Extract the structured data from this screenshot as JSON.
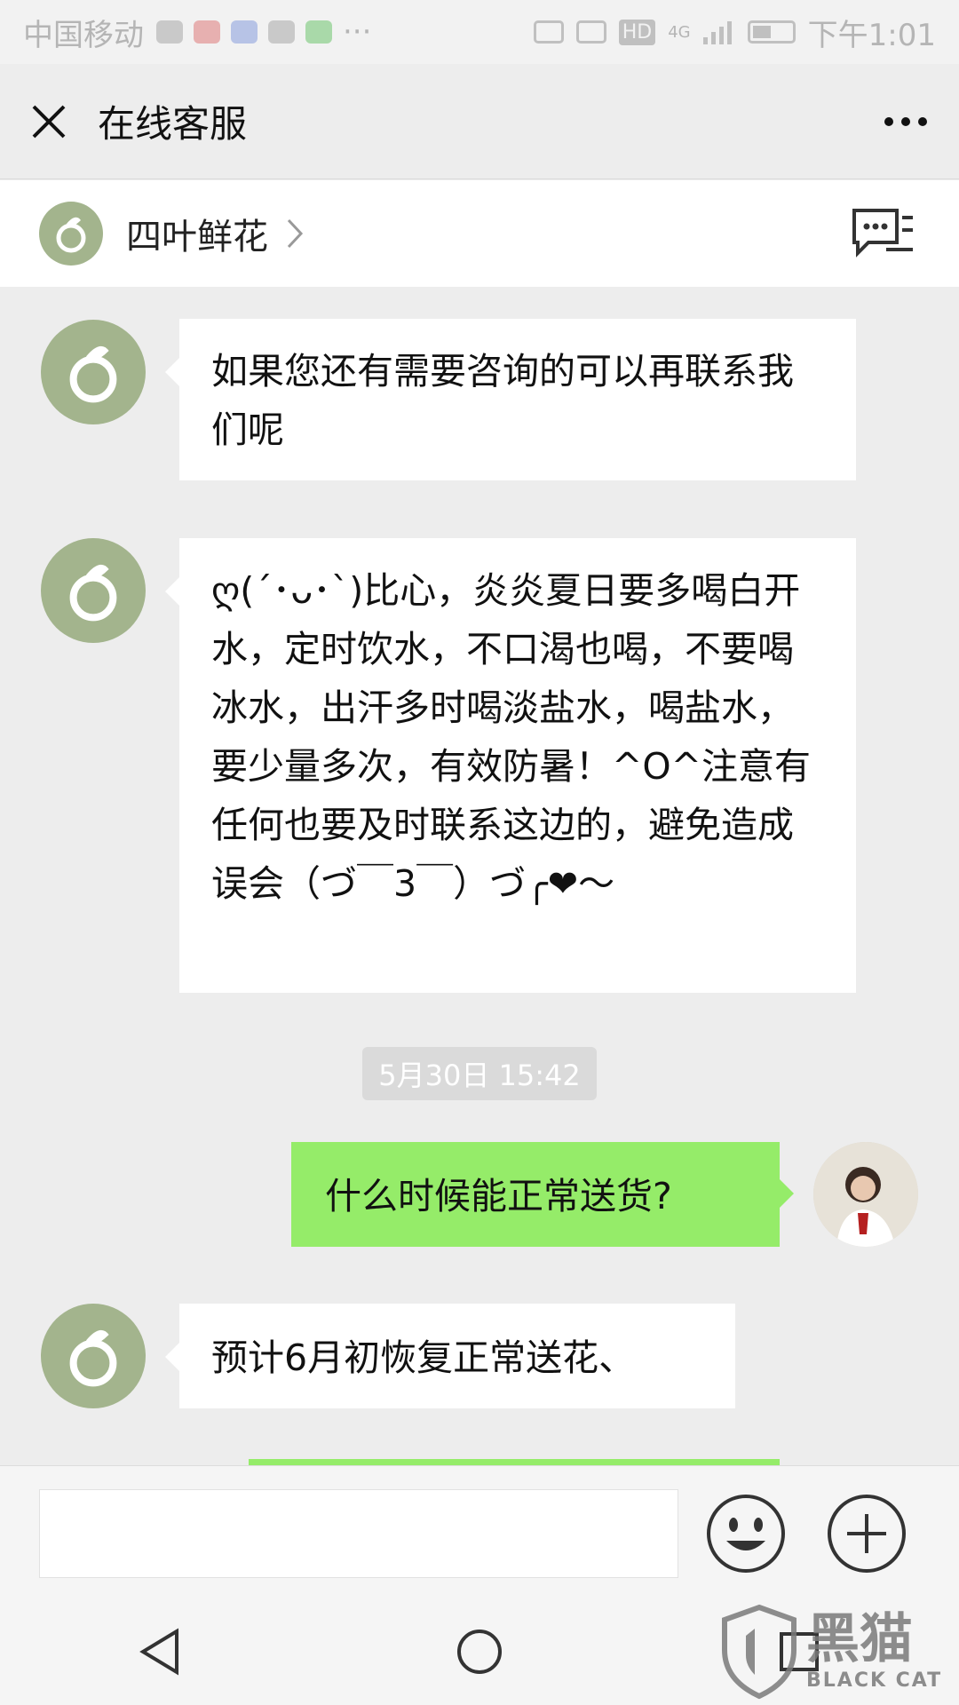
{
  "status_bar": {
    "carrier": "中国移动",
    "signal_labels": [
      "HD",
      "4G"
    ],
    "time": "下午1:01"
  },
  "header": {
    "title": "在线客服",
    "close_icon": "close-icon",
    "more_icon": "more-dots-icon"
  },
  "account": {
    "name": "四叶鲜花",
    "chevron_icon": "chevron-right-icon",
    "message_icon": "message-list-icon"
  },
  "messages": [
    {
      "side": "left",
      "text": "如果您还有需要咨询的可以再联系我们呢"
    },
    {
      "side": "left",
      "text": "ღ(´･ᴗ･`)比心，炎炎夏日要多喝白开水，定时饮水，不口渴也喝，不要喝冰水，出汗多时喝淡盐水，喝盐水，要少量多次，有效防暑！^O^注意有任何也要及时联系这边的，避免造成误会（づ￣3￣）づ╭❤～"
    },
    {
      "side": "right",
      "text": "什么时候能正常送货?"
    },
    {
      "side": "left",
      "text": "预计6月初恢复正常送花、"
    }
  ],
  "timestamp": "5月30日 15:42",
  "input_bar": {
    "placeholder": "",
    "emoji_icon": "emoji-icon",
    "plus_icon": "plus-icon"
  },
  "nav_bar": {
    "back_icon": "back-triangle-icon",
    "home_icon": "home-circle-icon",
    "recents_icon": "recents-square-icon"
  },
  "watermark": {
    "cn": "黑猫",
    "en": "BLACK CAT"
  },
  "colors": {
    "background": "#ededed",
    "bubble_left": "#ffffff",
    "bubble_right": "#95ec69",
    "avatar_green": "#a3b48d"
  }
}
